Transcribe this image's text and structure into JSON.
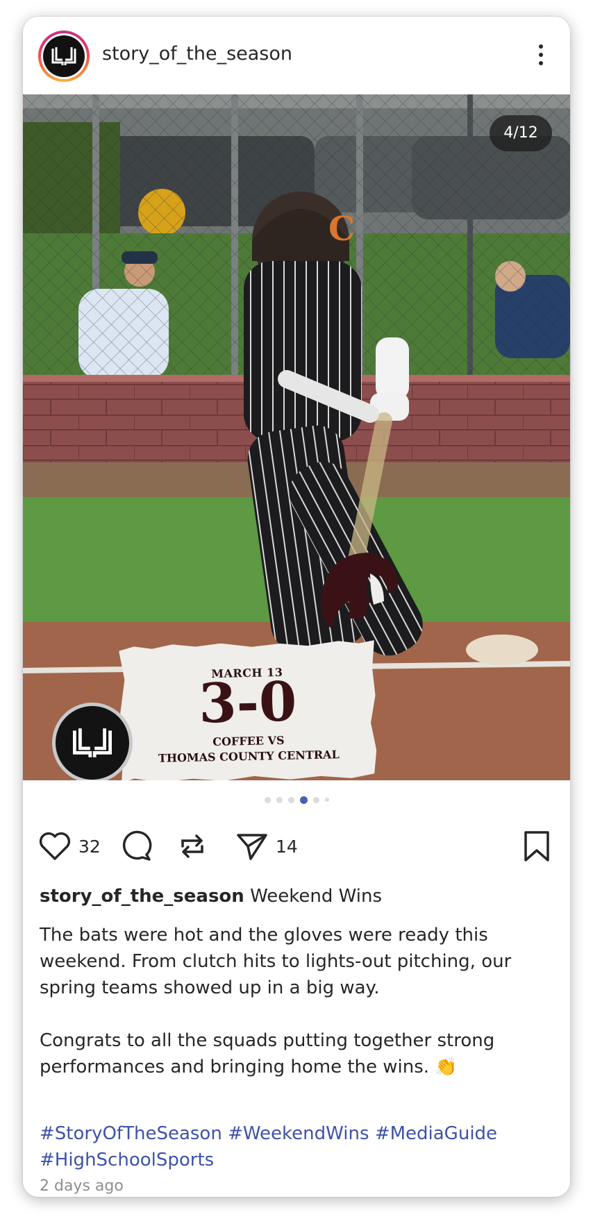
{
  "post": {
    "username": "story_of_the_season",
    "counter": "4/12",
    "likes": "32",
    "shares": "14",
    "caption_title": "Weekend Wins",
    "paragraph1": "The bats were hot and the gloves were ready this weekend. From clutch hits to lights-out pitching, our spring teams showed up in a big way.",
    "paragraph2": "Congrats to all the squads putting together strong performances and bringing home the wins. 👏",
    "hashtags": [
      "#StoryOfTheSeason",
      "#WeekendWins",
      "#MediaGuide",
      "#HighSchoolSports"
    ],
    "timestamp": "2 days ago"
  },
  "scorecard": {
    "date": "MARCH 13",
    "score": "3-0",
    "line1": "COFFEE VS",
    "line2": "THOMAS COUNTY CENTRAL"
  },
  "carousel": {
    "current_index": 4,
    "active_color": "#4a5fb4"
  },
  "icons": {
    "like": "heart-icon",
    "comment": "comment-bubble-icon",
    "repost": "repost-icon",
    "share": "send-icon",
    "save": "bookmark-icon",
    "more": "more-vertical-icon"
  }
}
